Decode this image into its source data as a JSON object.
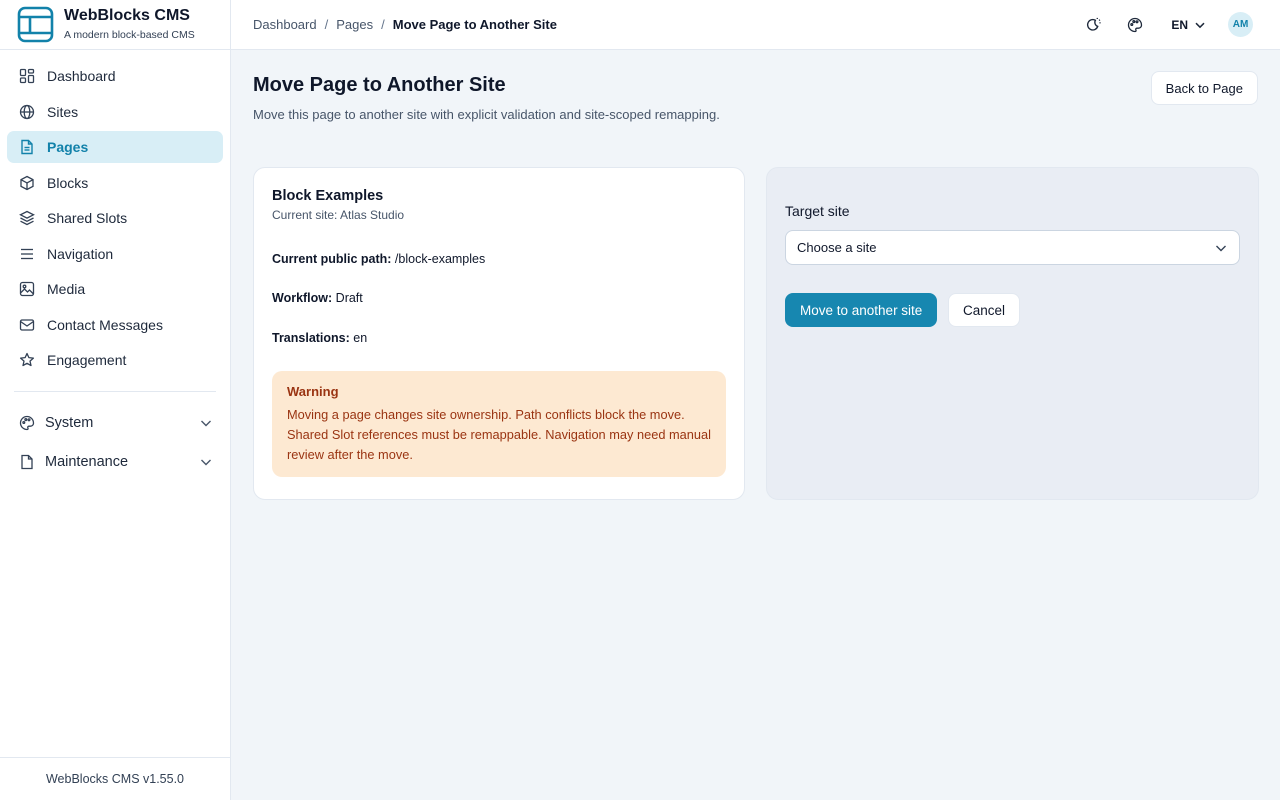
{
  "brand": {
    "name": "WebBlocks CMS",
    "tagline": "A modern block-based CMS",
    "logo_icon": "layout-logo-icon",
    "accent": "#1282aa"
  },
  "sidebar": {
    "items": [
      {
        "label": "Dashboard",
        "icon": "grid-icon",
        "active": false
      },
      {
        "label": "Sites",
        "icon": "globe-icon",
        "active": false
      },
      {
        "label": "Pages",
        "icon": "document-icon",
        "active": true
      },
      {
        "label": "Blocks",
        "icon": "cube-icon",
        "active": false
      },
      {
        "label": "Shared Slots",
        "icon": "layers-icon",
        "active": false
      },
      {
        "label": "Navigation",
        "icon": "menu-icon",
        "active": false
      },
      {
        "label": "Media",
        "icon": "image-icon",
        "active": false
      },
      {
        "label": "Contact Messages",
        "icon": "mail-icon",
        "active": false
      },
      {
        "label": "Engagement",
        "icon": "star-icon",
        "active": false
      }
    ],
    "groups": [
      {
        "label": "System",
        "icon": "palette-icon"
      },
      {
        "label": "Maintenance",
        "icon": "file-icon"
      }
    ],
    "footer": "WebBlocks CMS v1.55.0"
  },
  "breadcrumb": {
    "items": [
      "Dashboard",
      "Pages"
    ],
    "separator": "/",
    "current": "Move Page to Another Site"
  },
  "topbar": {
    "theme_icon": "theme-toggle-icon",
    "palette_icon": "palette-icon",
    "language": "EN",
    "avatar_initials": "AM"
  },
  "main": {
    "title": "Move Page to Another Site",
    "subtitle": "Move this page to another site with explicit validation and site-scoped remapping.",
    "back_label": "Back to Page"
  },
  "page_card": {
    "title": "Block Examples",
    "current_site": "Current site: Atlas Studio",
    "path_label": "Current public path:",
    "path_value": " /block-examples",
    "workflow_label": "Workflow:",
    "workflow_value": " Draft",
    "translations_label": "Translations:",
    "translations_value": " en"
  },
  "warning": {
    "title": "Warning",
    "text": "Moving a page changes site ownership. Path conflicts block the move. Shared Slot references must be remappable. Navigation may need manual review after the move.",
    "background": "#fde9d2",
    "color": "#9a3412"
  },
  "move_form": {
    "field_label": "Target site",
    "select_value": "Choose a site",
    "submit_label": "Move to another site",
    "cancel_label": "Cancel",
    "primary_color": "#1787b0"
  }
}
